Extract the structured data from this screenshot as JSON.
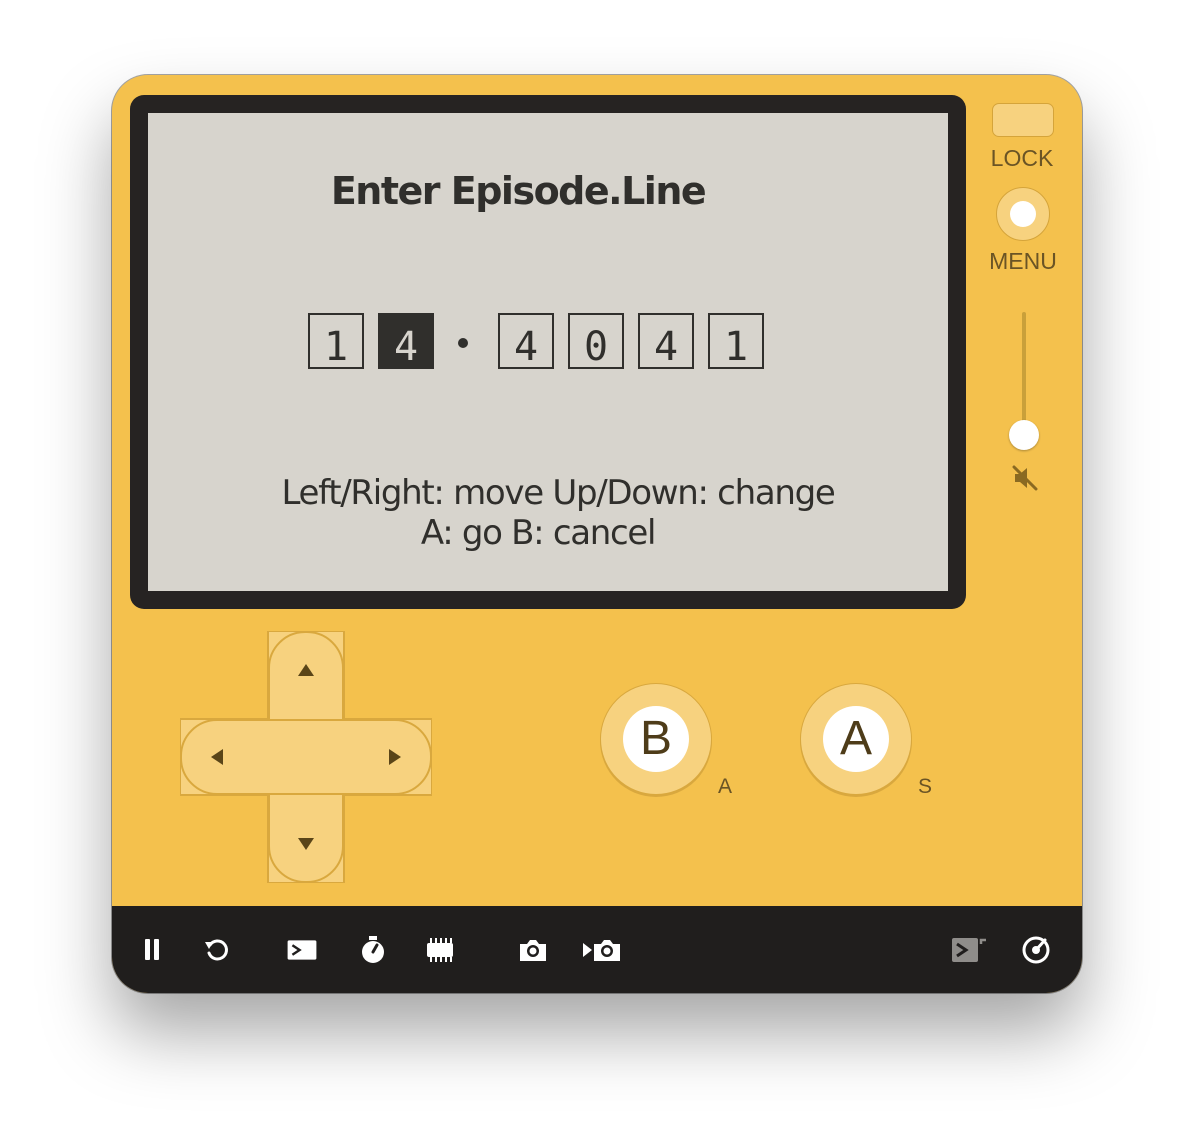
{
  "screen": {
    "title": "Enter Episode.Line",
    "digits": [
      "1",
      "4",
      "4",
      "0",
      "4",
      "1"
    ],
    "selected_digit_index": 1,
    "help_line1": "Left/Right: move   Up/Down: change",
    "help_line2": "A: go   B: cancel"
  },
  "side_controls": {
    "lock_label": "LOCK",
    "menu_label": "MENU",
    "volume_level": 0.0,
    "mute_icon": "speaker-muted-icon"
  },
  "buttons": {
    "b_label": "B",
    "a_label": "A",
    "b_key_hint": "A",
    "a_key_hint": "S"
  },
  "dpad": {
    "up_icon": "arrow-up-icon",
    "down_icon": "arrow-down-icon",
    "left_icon": "arrow-left-icon",
    "right_icon": "arrow-right-icon"
  },
  "toolbar": {
    "icons": [
      "pause-icon",
      "restart-icon",
      "console-icon",
      "stopwatch-icon",
      "cpu-icon",
      "screenshot-icon",
      "record-video-icon",
      "console-stream-icon",
      "settings-dial-icon"
    ]
  },
  "colors": {
    "device_body": "#f4c14d",
    "screen_bg": "#d7d4cd",
    "screen_ink": "#302f2c",
    "button_face": "#f7d27f",
    "toolbar_bg": "#201e1d"
  }
}
